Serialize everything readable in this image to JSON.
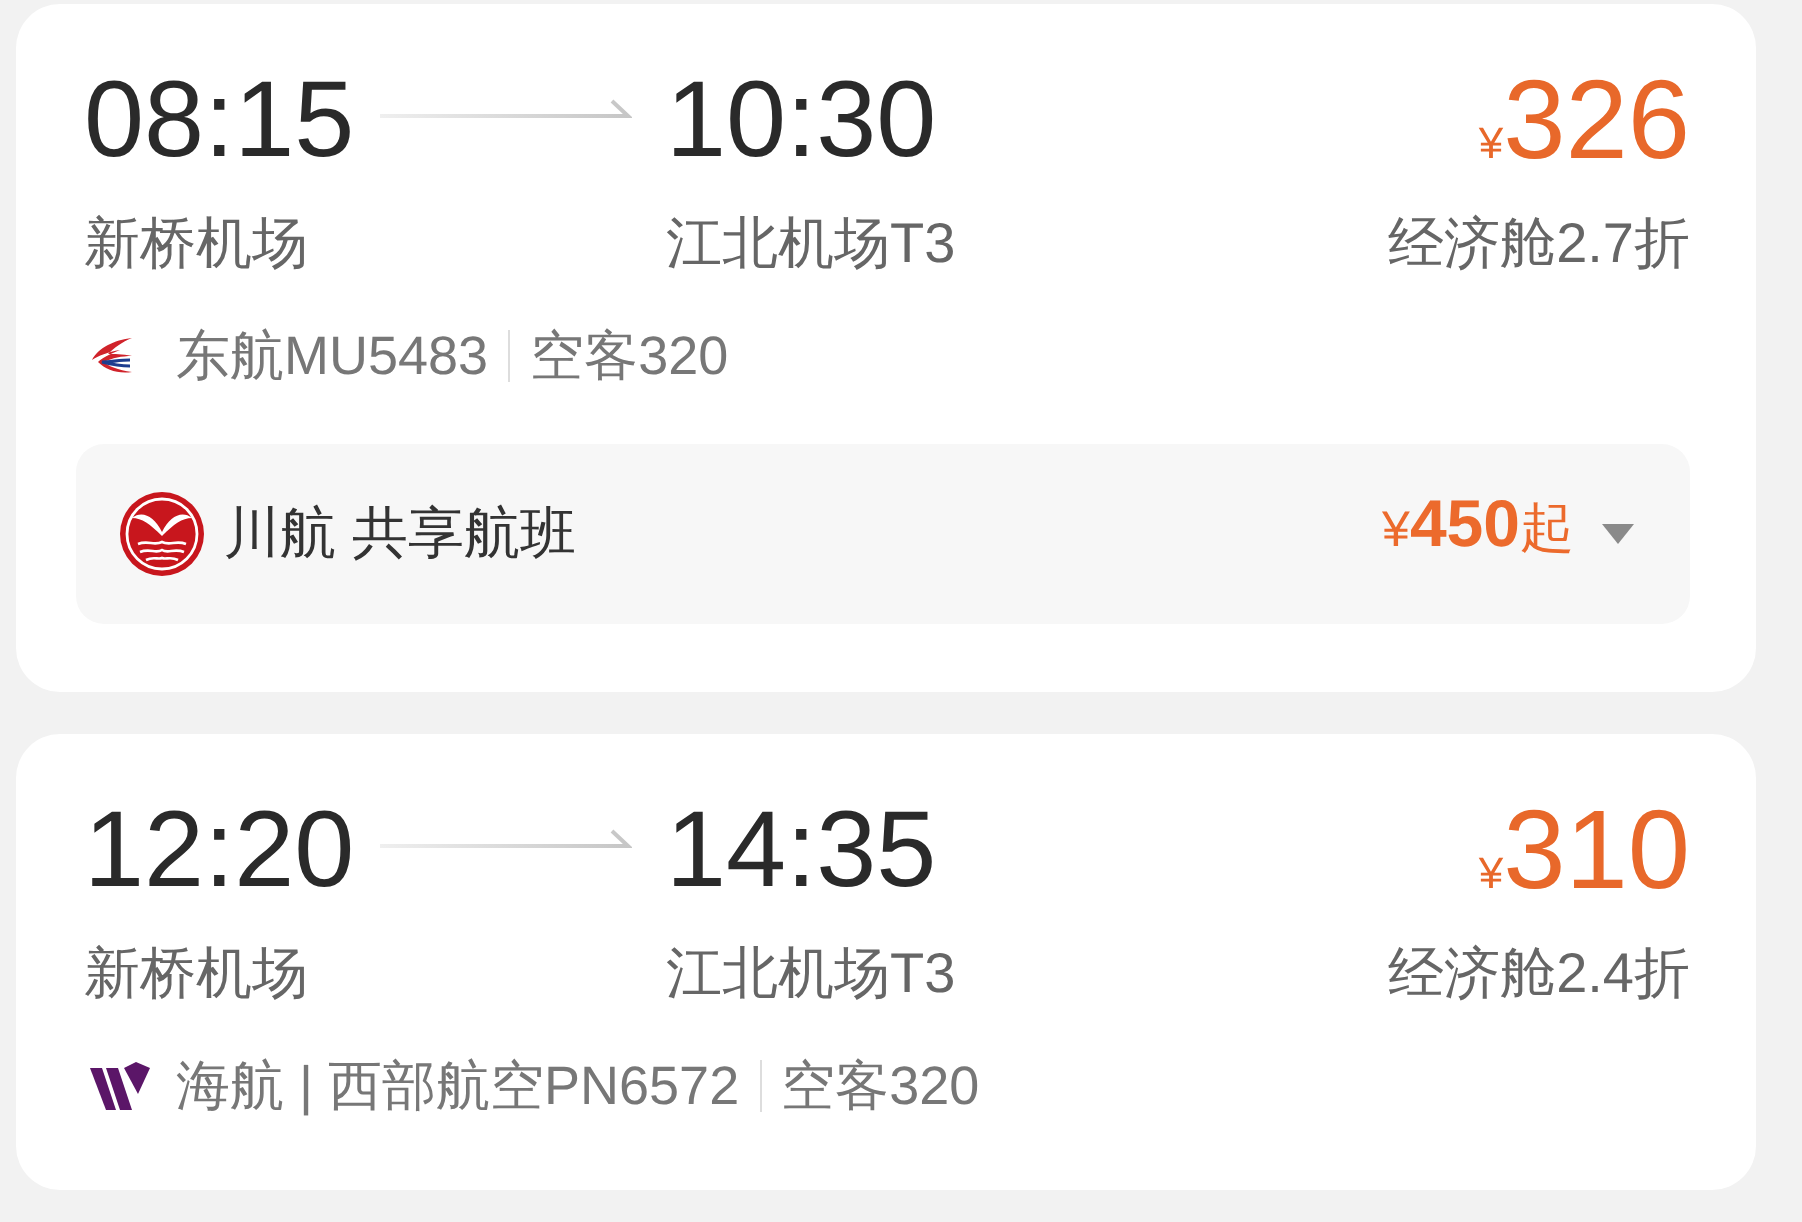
{
  "flights": [
    {
      "departure": {
        "time": "08:15",
        "airport": "新桥机场"
      },
      "arrival": {
        "time": "10:30",
        "airport": "江北机场T3"
      },
      "price": {
        "currency": "¥",
        "amount": "326"
      },
      "cabin": "经济舱2.7折",
      "carrier": {
        "kind": "swoosh",
        "details": [
          "东航MU5483",
          "空客320"
        ]
      },
      "codeshare": {
        "label": "川航 共享航班",
        "price": {
          "currency": "¥",
          "amount": "450",
          "suffix": "起"
        },
        "expanded": false
      }
    },
    {
      "departure": {
        "time": "12:20",
        "airport": "新桥机场"
      },
      "arrival": {
        "time": "14:35",
        "airport": "江北机场T3"
      },
      "price": {
        "currency": "¥",
        "amount": "310"
      },
      "cabin": "经济舱2.4折",
      "carrier": {
        "kind": "stripes",
        "details": [
          "海航 | 西部航空PN6572",
          "空客320"
        ]
      }
    }
  ]
}
